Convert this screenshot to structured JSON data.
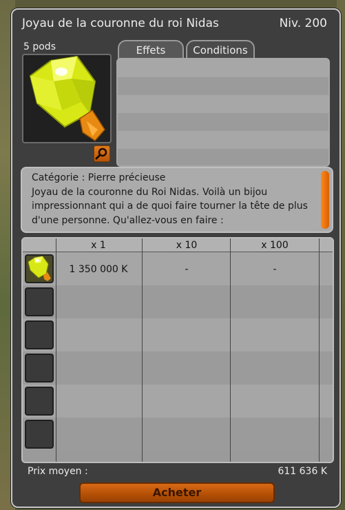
{
  "item": {
    "name": "Joyau de la couronne du roi Nidas",
    "level": "Niv. 200",
    "pods": "5 pods"
  },
  "tabs": [
    {
      "label": "Effets"
    },
    {
      "label": "Conditions"
    }
  ],
  "description": {
    "category": "Catégorie : Pierre précieuse",
    "text": "Joyau de la couronne du Roi Nidas. Voilà un bijou impressionnant qui a de quoi faire tourner la tête de plus d'une personne. Qu'allez-vous en faire :"
  },
  "price_table": {
    "headers": [
      "x 1",
      "x 10",
      "x 100"
    ],
    "rows": [
      {
        "x1": "1 350 000 K",
        "x10": "-",
        "x100": "-"
      }
    ]
  },
  "average_price": {
    "label": "Prix moyen :",
    "value": "611 636 K"
  },
  "buy_button": {
    "label": "Acheter"
  },
  "colors": {
    "accent_orange": "#d86a16",
    "gem_yellow": "#e6f21a"
  },
  "icons": {
    "item": "gem-icon",
    "zoom": "magnifier-icon"
  }
}
